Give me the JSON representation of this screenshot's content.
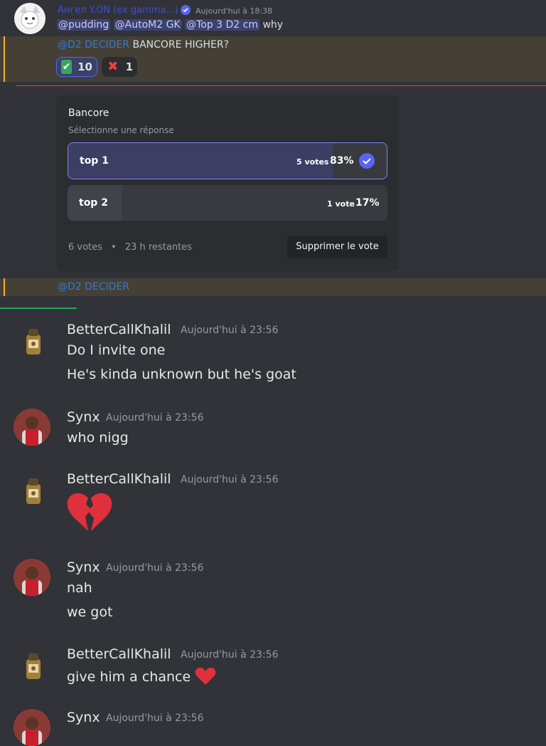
{
  "top_message": {
    "author": "Ангел Y.ON (ex gamma...)",
    "timestamp": "Aujourd'hui à 18:38",
    "mentions": [
      "@pudding",
      "@AutoM2 GK",
      "@Top 3 D2 cm"
    ],
    "text": "why"
  },
  "reply_message": {
    "mention": "@D2 DECIDER",
    "text": "BANCORE HIGHER?",
    "reactions": [
      {
        "emoji": "✔",
        "count": "10",
        "active": true
      },
      {
        "emoji": "✖",
        "count": "1",
        "active": false
      }
    ]
  },
  "poll": {
    "question": "Bancore",
    "subtitle": "Sélectionne une réponse",
    "options": [
      {
        "label": "top 1",
        "votes": "5 votes",
        "percent": "83%",
        "fill": 0.83,
        "selected": true
      },
      {
        "label": "top 2",
        "votes": "1 vote",
        "percent": "17%",
        "fill": 0.17,
        "selected": false
      }
    ],
    "total_votes": "6 votes",
    "remaining": "23 h restantes",
    "remove_vote_label": "Supprimer le vote"
  },
  "mention_row": {
    "text": "@D2 DECIDER"
  },
  "messages": [
    {
      "author": "BetterCallKhalil",
      "timestamp": "Aujourd'hui à 23:56",
      "lines": [
        "Do I invite one",
        "He's kinda unknown but he's goat"
      ]
    },
    {
      "author": "Synx",
      "timestamp": "Aujourd'hui à 23:56",
      "lines": [
        "who nigg"
      ]
    },
    {
      "author": "BetterCallKhalil",
      "timestamp": "Aujourd'hui à 23:56",
      "emoji": "broken-heart"
    },
    {
      "author": "Synx",
      "timestamp": "Aujourd'hui à 23:56",
      "lines": [
        "nah",
        "we got"
      ]
    },
    {
      "author": "BetterCallKhalil",
      "timestamp": "Aujourd'hui à 23:56",
      "lines": [
        "give him a chance"
      ],
      "trailing_emoji": "red-heart"
    },
    {
      "author": "Synx",
      "timestamp": "Aujourd'hui à 23:56"
    }
  ],
  "colors": {
    "background": "#313338",
    "highlight": "#444036",
    "accent": "#5865f2",
    "mention_bg": "#3c4270",
    "selected_fill": "#3c3f63"
  }
}
